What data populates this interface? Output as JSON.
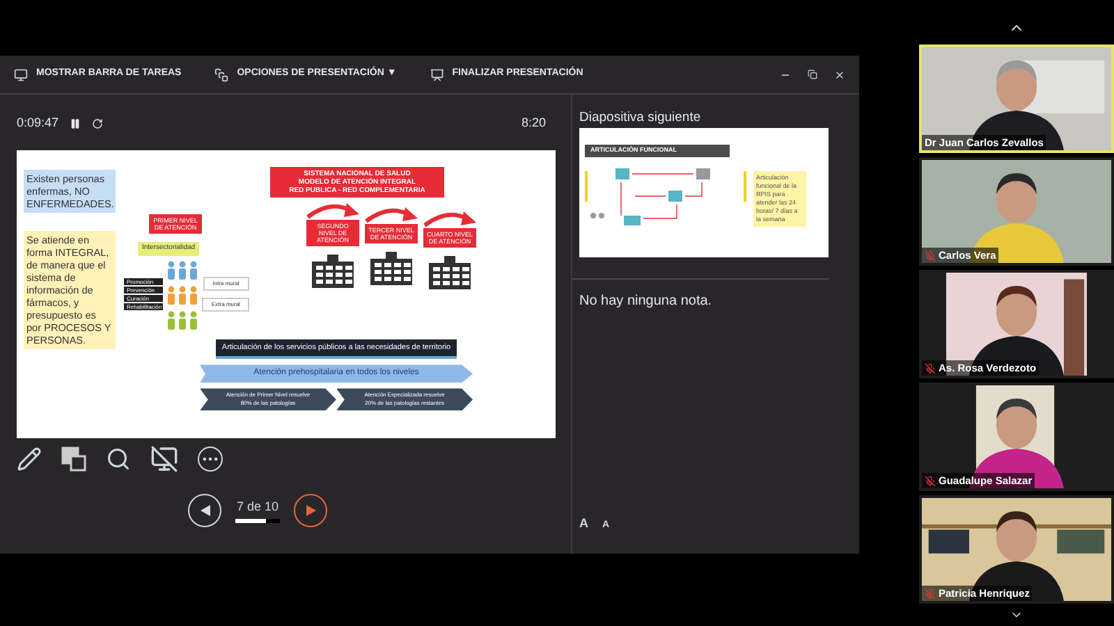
{
  "toolbar": [
    {
      "kind": "taskbar",
      "label": "MOSTRAR BARRA DE TAREAS"
    },
    {
      "kind": "options",
      "label": "OPCIONES DE PRESENTACIÓN ▼"
    },
    {
      "kind": "end",
      "label": "FINALIZAR PRESENTACIÓN"
    }
  ],
  "timer": {
    "elapsed": "0:09:47",
    "clock": "8:20"
  },
  "slide": {
    "notes": [
      {
        "text": "Existen personas enfermas, NO ENFERMEDADES.",
        "color": "#c6ddf6"
      },
      {
        "text": "Se atiende en forma INTEGRAL, de manera que el sistema de información de fármacos, y presupuesto es por PROCESOS Y PERSONAS.",
        "color": "#fff1b8"
      }
    ],
    "title_lines": [
      "SISTEMA NACIONAL DE SALUD",
      "MODELO DE ATENCIÓN INTEGRAL",
      "RED PUBLICA - RED COMPLEMENTARIA"
    ],
    "levels": [
      {
        "label": "PRIMER NIVEL DE ATENCIÓN"
      },
      {
        "label": "SEGUNDO NIVEL DE ATENCIÓN"
      },
      {
        "label": "TERCER NIVEL DE ATENCIÓN"
      },
      {
        "label": "CUARTO NIVEL DE ATENCIÓN"
      }
    ],
    "tag": "Intersectorialidad",
    "actions": [
      "Promoción",
      "Prevención",
      "Curación",
      "Rehabilitación"
    ],
    "mural": [
      "Intra mural",
      "Extra mural"
    ],
    "territory_bar": "Articulación de los servicios públicos a las necesidades de territorio",
    "prehospital_bar": "Atención prehospitalaria en todos los niveles",
    "chevrons": [
      {
        "line1": "Atención de Primer Nivel resuelve",
        "line2": "80% de las patologías"
      },
      {
        "line1": "Atención Especializada resuelve",
        "line2": "20% de las patologías restantes"
      }
    ]
  },
  "next_slide": {
    "heading": "Diapositiva siguiente",
    "title": "ARTICULACIÓN FUNCIONAL",
    "note": "Articulación funcional de la RPIS para atender las 24 horas/ 7 días a la semana"
  },
  "notes_text": "No hay ninguna nota.",
  "navigation": {
    "counter": "7 de 10",
    "level": 0.7
  },
  "font_buttons": [
    {
      "kind": "grow",
      "label": "A"
    },
    {
      "kind": "shrink",
      "label": "A"
    }
  ],
  "participants": [
    {
      "name": "Dr Juan Carlos Zevallos",
      "muted": false,
      "speaking": true
    },
    {
      "name": "Carlos Vera",
      "muted": true,
      "speaking": false
    },
    {
      "name": "As. Rosa Verdezoto",
      "muted": true,
      "speaking": false
    },
    {
      "name": "Guadalupe Salazar",
      "muted": true,
      "speaking": false
    },
    {
      "name": "Patricia Henriquez",
      "muted": true,
      "speaking": false
    }
  ]
}
